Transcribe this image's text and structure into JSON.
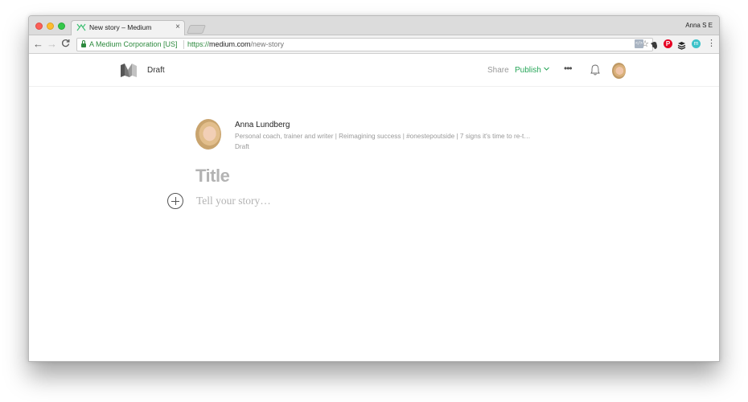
{
  "browser": {
    "tab": {
      "title": "New story – Medium",
      "close_icon": "close-icon",
      "favicon": "medium-logo-icon"
    },
    "profile_name": "Anna S E",
    "toolbar": {
      "back_icon": "←",
      "forward_icon": "→",
      "reload_icon": "C",
      "ev_name": "A Medium Corporation [US]",
      "url_scheme": "https://",
      "url_host": "medium.com",
      "url_path": "/new-story",
      "bookmark_icon": "☆",
      "extensions": [
        {
          "name": "code-extension-icon",
          "glyph": "</>"
        },
        {
          "name": "evernote-icon",
          "glyph": ""
        },
        {
          "name": "pinterest-icon",
          "glyph": "P"
        },
        {
          "name": "buffer-icon",
          "glyph": ""
        },
        {
          "name": "m-extension-icon",
          "glyph": "m"
        }
      ],
      "menu_icon": "⋮"
    }
  },
  "header": {
    "status": "Draft",
    "share_label": "Share",
    "publish_label": "Publish",
    "more_icon": "•••"
  },
  "author": {
    "name": "Anna Lundberg",
    "bio": "Personal coach, trainer and writer | Reimagining success | #onestepoutside | 7 signs it's time to re-t…",
    "status": "Draft"
  },
  "editor": {
    "title_placeholder": "Title",
    "body_placeholder": "Tell your story…"
  },
  "colors": {
    "accent_green": "#26a658",
    "secure_green": "#2d8a3e",
    "placeholder_gray": "#b3b3b3"
  }
}
